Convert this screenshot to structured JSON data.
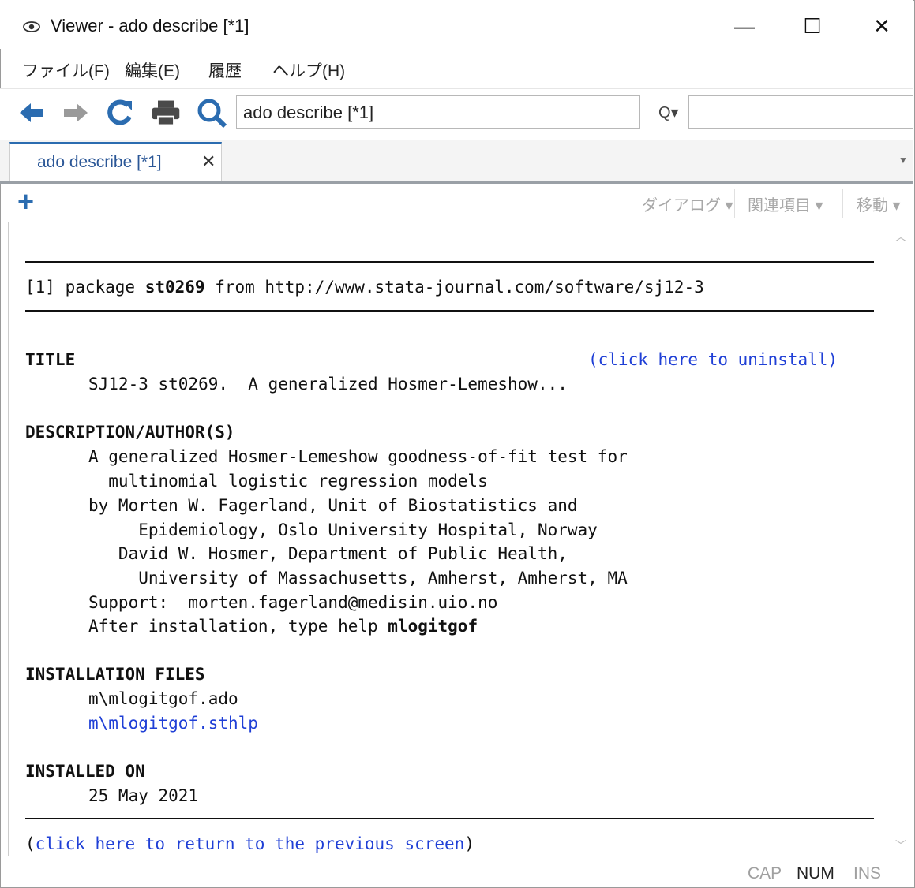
{
  "window": {
    "title": "Viewer - ado describe [*1]",
    "minimize": "—",
    "maximize": "☐",
    "close": "✕"
  },
  "menu": [
    "ファイル(F)",
    "編集(E)",
    "履歴",
    "ヘルプ(H)"
  ],
  "toolbar": {
    "address_value": "ado describe [*1]",
    "search_icon_small": "Q▾"
  },
  "tab": {
    "label": "ado describe [*1]",
    "close": "✕"
  },
  "subtoolbar": {
    "add": "+",
    "dialog": "ダイアログ ▾",
    "related": "関連項目 ▾",
    "jump": "移動 ▾"
  },
  "content": {
    "header_prefix": "[1] package ",
    "package_name": "st0269",
    "header_suffix": " from http://www.stata-journal.com/software/sj12-3",
    "title_heading": "TITLE",
    "uninstall_link": "(click here to uninstall)",
    "title_text": "SJ12-3 st0269.  A generalized Hosmer-Lemeshow...",
    "desc_heading": "DESCRIPTION/AUTHOR(S)",
    "desc_lines": [
      "A generalized Hosmer-Lemeshow goodness-of-fit test for",
      "  multinomial logistic regression models",
      "by Morten W. Fagerland, Unit of Biostatistics and",
      "     Epidemiology, Oslo University Hospital, Norway",
      "   David W. Hosmer, Department of Public Health,",
      "     University of Massachusetts, Amherst, Amherst, MA",
      "Support:  morten.fagerland@medisin.uio.no"
    ],
    "after_install_prefix": "After installation, type help ",
    "after_install_cmd": "mlogitgof",
    "install_heading": "INSTALLATION FILES",
    "install_file_1": "m\\mlogitgof.ado",
    "install_file_2": "m\\mlogitgof.sthlp",
    "installed_heading": "INSTALLED ON",
    "installed_date": "25 May 2021",
    "return_open": "(",
    "return_link": "click here to return to the previous screen",
    "return_close": ")"
  },
  "status": {
    "cap": "CAP",
    "num": "NUM",
    "ins": "INS"
  },
  "colors": {
    "link": "#1f3fd6",
    "accent": "#2b6cb0"
  }
}
